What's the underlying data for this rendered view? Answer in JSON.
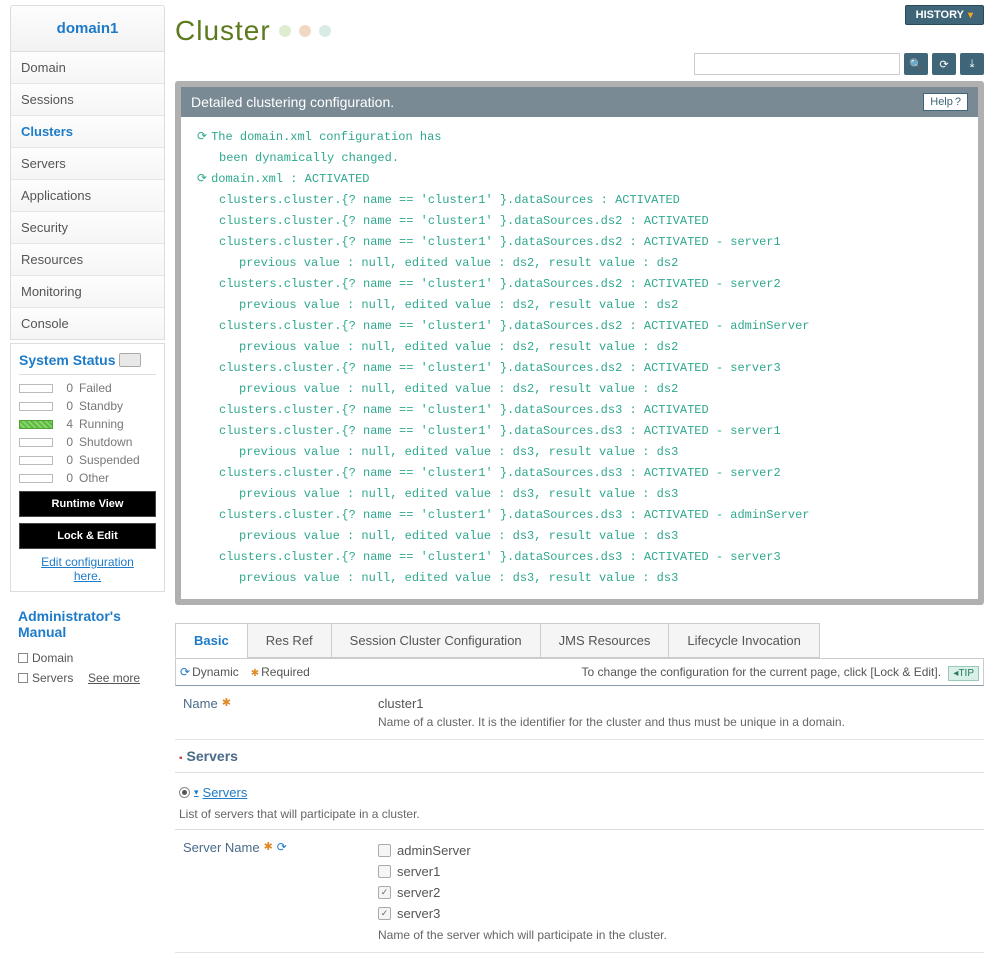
{
  "sidebar": {
    "title": "domain1",
    "items": [
      "Domain",
      "Sessions",
      "Clusters",
      "Servers",
      "Applications",
      "Security",
      "Resources",
      "Monitoring",
      "Console"
    ],
    "activeIndex": 2
  },
  "status": {
    "title": "System Status",
    "rows": [
      {
        "count": "0",
        "label": "Failed",
        "green": false
      },
      {
        "count": "0",
        "label": "Standby",
        "green": false
      },
      {
        "count": "4",
        "label": "Running",
        "green": true
      },
      {
        "count": "0",
        "label": "Shutdown",
        "green": false
      },
      {
        "count": "0",
        "label": "Suspended",
        "green": false
      },
      {
        "count": "0",
        "label": "Other",
        "green": false
      }
    ],
    "runtimeBtn": "Runtime View",
    "lockBtn": "Lock & Edit",
    "editLink1": "Edit configuration",
    "editLink2": "here."
  },
  "manual": {
    "title": "Administrator's Manual",
    "items": [
      "Domain",
      "Servers"
    ],
    "more": "See more"
  },
  "header": {
    "pageTitle": "Cluster",
    "historyBtn": "HISTORY"
  },
  "panel": {
    "title": "Detailed clustering configuration.",
    "helpBtn": "Help",
    "log": [
      {
        "icon": true,
        "indent": 0,
        "text": "The domain.xml configuration has"
      },
      {
        "icon": false,
        "indent": 1,
        "text": "been dynamically changed."
      },
      {
        "icon": true,
        "indent": 0,
        "text": "domain.xml : ACTIVATED"
      },
      {
        "icon": false,
        "indent": 1,
        "text": "clusters.cluster.{? name == 'cluster1' }.dataSources : ACTIVATED"
      },
      {
        "icon": false,
        "indent": 1,
        "text": "clusters.cluster.{? name == 'cluster1' }.dataSources.ds2 : ACTIVATED"
      },
      {
        "icon": false,
        "indent": 1,
        "text": "clusters.cluster.{? name == 'cluster1' }.dataSources.ds2 : ACTIVATED - server1"
      },
      {
        "icon": false,
        "indent": 2,
        "text": "previous value : null, edited value : ds2, result value : ds2"
      },
      {
        "icon": false,
        "indent": 1,
        "text": "clusters.cluster.{? name == 'cluster1' }.dataSources.ds2 : ACTIVATED - server2"
      },
      {
        "icon": false,
        "indent": 2,
        "text": "previous value : null, edited value : ds2, result value : ds2"
      },
      {
        "icon": false,
        "indent": 1,
        "text": "clusters.cluster.{? name == 'cluster1' }.dataSources.ds2 : ACTIVATED - adminServer"
      },
      {
        "icon": false,
        "indent": 2,
        "text": "previous value : null, edited value : ds2, result value : ds2"
      },
      {
        "icon": false,
        "indent": 1,
        "text": "clusters.cluster.{? name == 'cluster1' }.dataSources.ds2 : ACTIVATED - server3"
      },
      {
        "icon": false,
        "indent": 2,
        "text": "previous value : null, edited value : ds2, result value : ds2"
      },
      {
        "icon": false,
        "indent": 1,
        "text": "clusters.cluster.{? name == 'cluster1' }.dataSources.ds3 : ACTIVATED"
      },
      {
        "icon": false,
        "indent": 1,
        "text": "clusters.cluster.{? name == 'cluster1' }.dataSources.ds3 : ACTIVATED - server1"
      },
      {
        "icon": false,
        "indent": 2,
        "text": "previous value : null, edited value : ds3, result value : ds3"
      },
      {
        "icon": false,
        "indent": 1,
        "text": "clusters.cluster.{? name == 'cluster1' }.dataSources.ds3 : ACTIVATED - server2"
      },
      {
        "icon": false,
        "indent": 2,
        "text": "previous value : null, edited value : ds3, result value : ds3"
      },
      {
        "icon": false,
        "indent": 1,
        "text": "clusters.cluster.{? name == 'cluster1' }.dataSources.ds3 : ACTIVATED - adminServer"
      },
      {
        "icon": false,
        "indent": 2,
        "text": "previous value : null, edited value : ds3, result value : ds3"
      },
      {
        "icon": false,
        "indent": 1,
        "text": "clusters.cluster.{? name == 'cluster1' }.dataSources.ds3 : ACTIVATED - server3"
      },
      {
        "icon": false,
        "indent": 2,
        "text": "previous value : null, edited value : ds3, result value : ds3"
      }
    ]
  },
  "tabs": [
    "Basic",
    "Res Ref",
    "Session Cluster Configuration",
    "JMS Resources",
    "Lifecycle Invocation"
  ],
  "legend": {
    "dynamic": "Dynamic",
    "required": "Required",
    "hint": "To change the configuration for the current page, click [Lock & Edit].",
    "tip": "TIP"
  },
  "basic": {
    "nameLabel": "Name",
    "nameValue": "cluster1",
    "nameDesc": "Name of a cluster. It is the identifier for the cluster and thus must be unique in a domain.",
    "serversTitle": "Servers",
    "serversLink": "Servers",
    "serversDesc": "List of servers that will participate in a cluster.",
    "srvNameLabel": "Server Name",
    "servers": [
      {
        "name": "adminServer",
        "checked": false
      },
      {
        "name": "server1",
        "checked": false
      },
      {
        "name": "server2",
        "checked": true
      },
      {
        "name": "server3",
        "checked": true
      }
    ],
    "srvNameDesc": "Name of the server which will participate in the cluster."
  }
}
